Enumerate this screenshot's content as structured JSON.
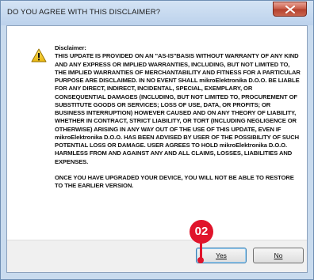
{
  "window": {
    "title": "DO YOU AGREE WITH THIS DISCLAIMER?",
    "close_icon": "close-icon"
  },
  "dialog": {
    "icon": "warning-icon",
    "heading": "Disclaimer:",
    "body": "THIS UPDATE IS PROVIDED ON AN \"AS-IS\"BASIS WITHOUT WARRANTY OF ANY KIND AND ANY EXPRESS OR IMPLIED WARRANTIES, INCLUDING, BUT NOT LIMITED TO, THE IMPLIED WARRANTIES OF MERCHANTABILITY AND FITNESS FOR A PARTICULAR PURPOSE ARE DISCLAIMED. IN NO EVENT SHALL mikroElektronika D.O.O. BE LIABLE FOR ANY DIRECT, INDIRECT, INCIDENTAL, SPECIAL, EXEMPLARY, OR CONSEQUENTIAL DAMAGES (INCLUDING, BUT NOT LIMITED TO, PROCUREMENT OF SUBSTITUTE GOODS OR SERVICES; LOSS OF USE, DATA, OR PROFITS; OR BUSINESS INTERRUPTION) HOWEVER CAUSED AND ON ANY THEORY OF LIABILITY, WHETHER IN CONTRACT, STRICT LIABILITY, OR TORT (INCLUDING NEGLIGENCE OR OTHERWISE) ARISING IN ANY WAY OUT OF THE USE OF THIS UPDATE, EVEN IF mikroElektronika D.O.O. HAS BEEN ADVISED BY USER OF THE POSSIBILITY OF SUCH POTENTIAL LOSS OR DAMAGE. USER AGREES TO HOLD mikroElektronika D.O.O. HARMLESS FROM AND AGAINST ANY AND ALL CLAIMS, LOSSES, LIABILITIES AND EXPENSES.",
    "note": "ONCE YOU HAVE UPGRADED YOUR DEVICE, YOU WILL NOT BE ABLE TO RESTORE TO THE EARLIER VERSION."
  },
  "buttons": {
    "yes": "Yes",
    "no": "No"
  },
  "annotation": {
    "marker_label": "02",
    "color": "#e0142b"
  }
}
